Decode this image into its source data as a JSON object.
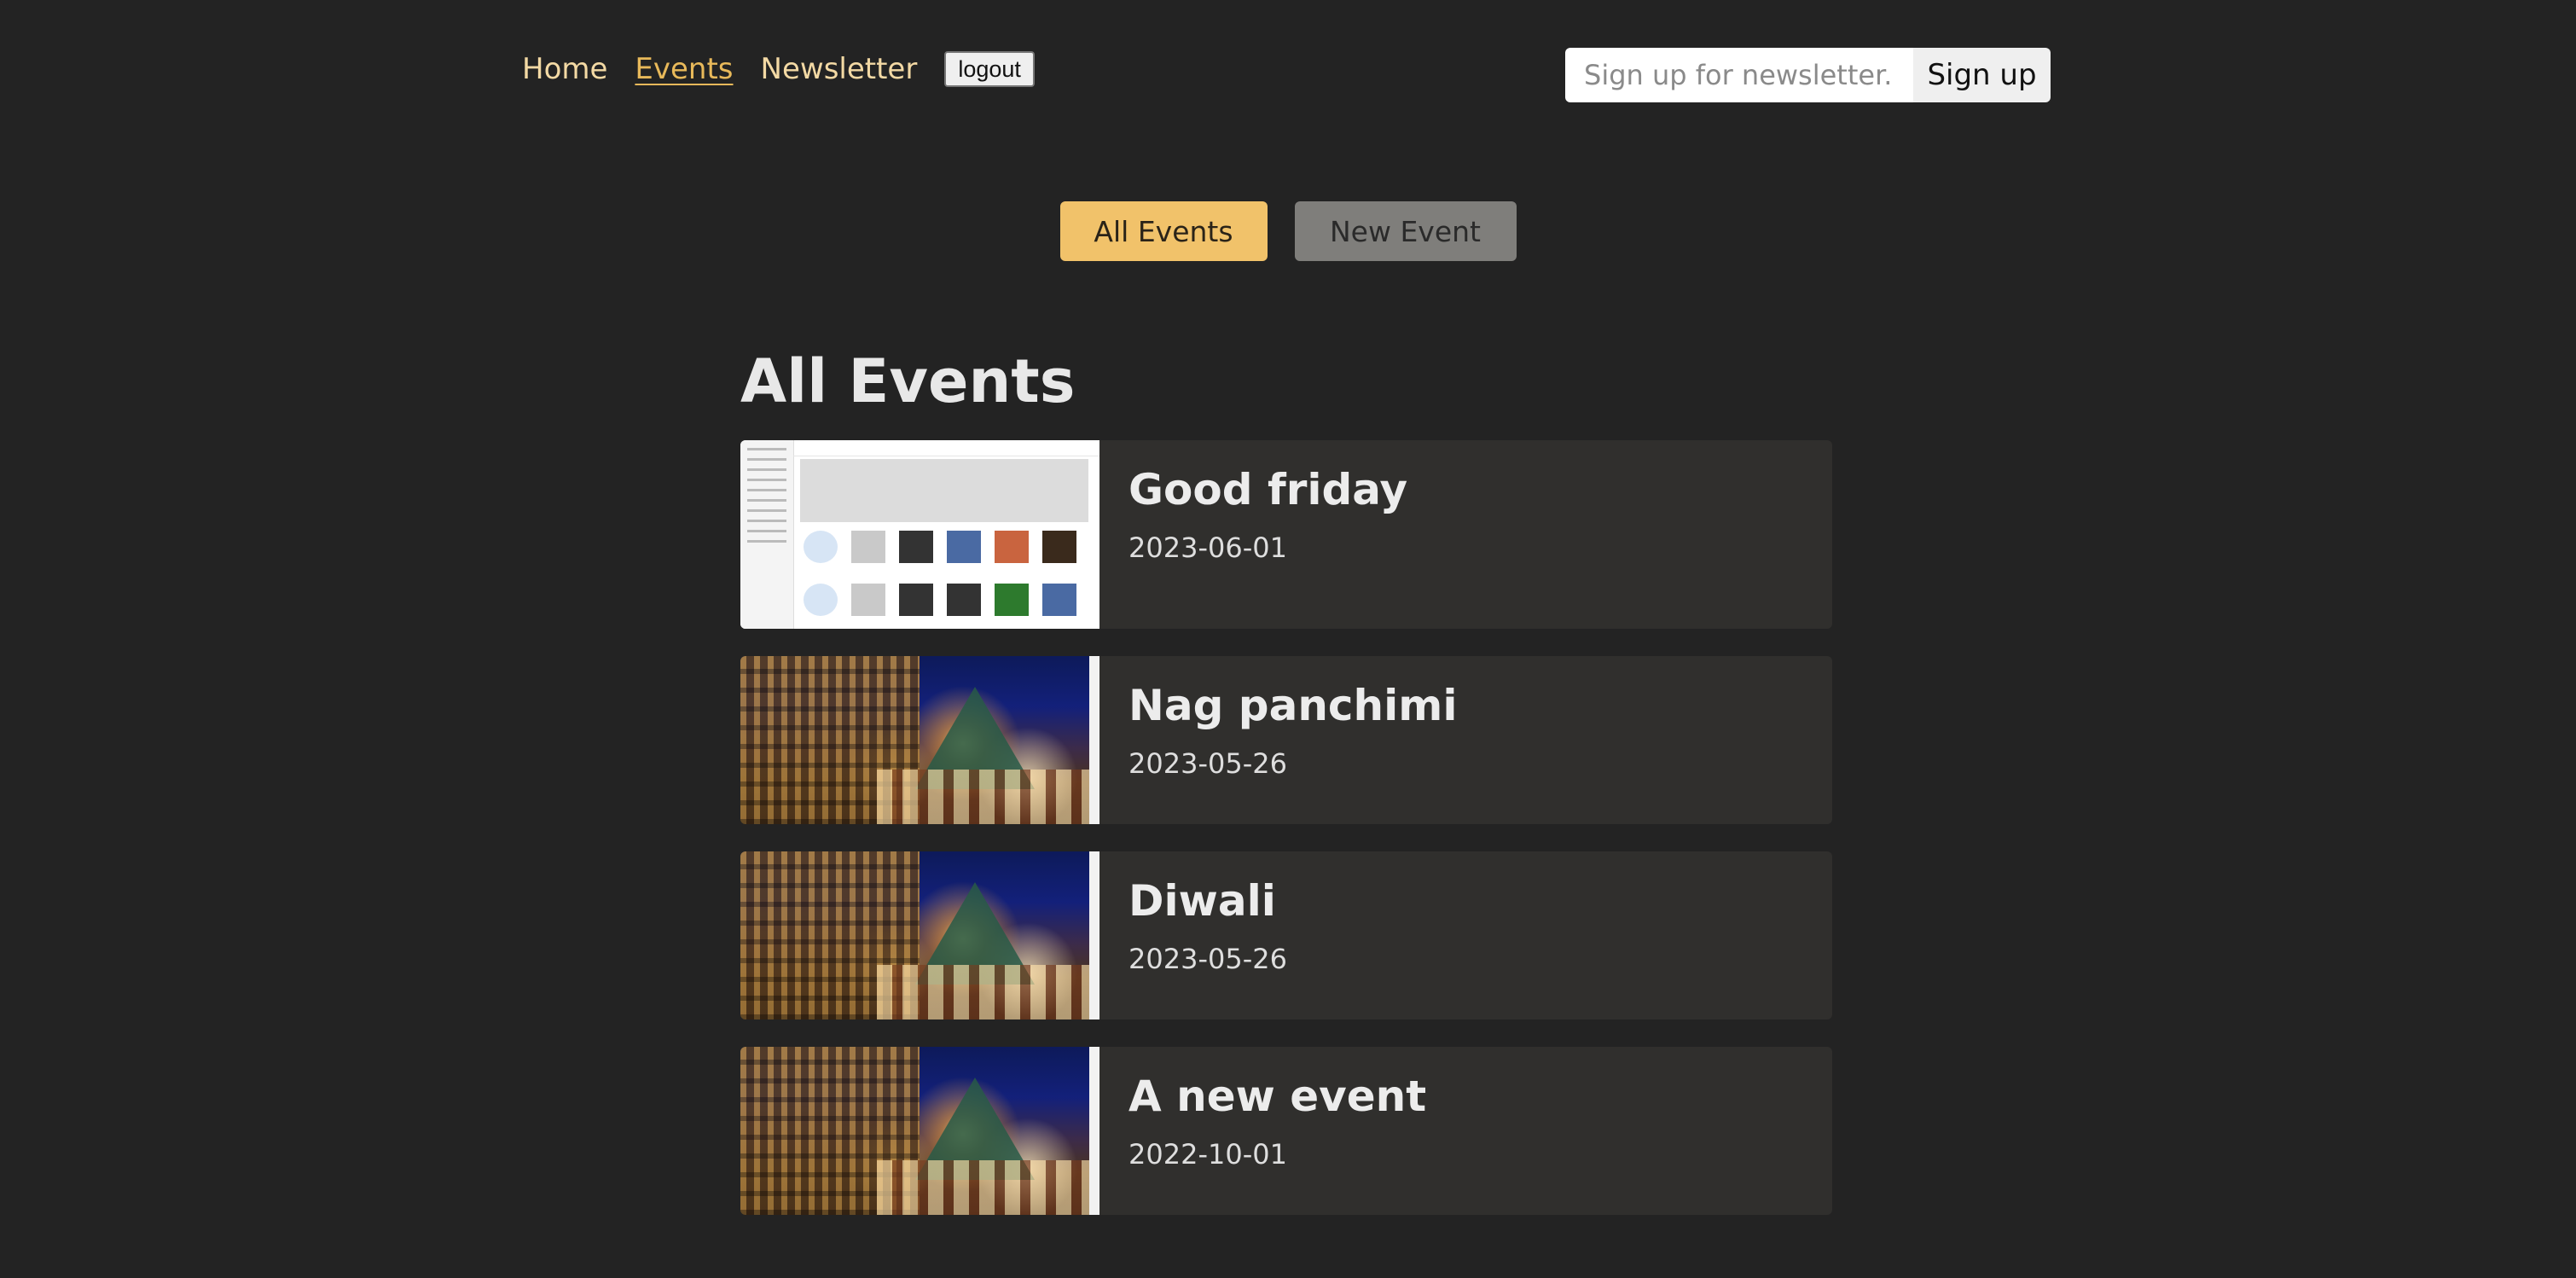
{
  "nav": {
    "links": [
      {
        "label": "Home"
      },
      {
        "label": "Events"
      },
      {
        "label": "Newsletter"
      }
    ],
    "logout_label": "logout"
  },
  "newsletter": {
    "placeholder": "Sign up for newsletter...",
    "value": "",
    "submit_label": "Sign up"
  },
  "tabs": {
    "all_events": "All Events",
    "new_event": "New Event"
  },
  "page": {
    "title": "All Events"
  },
  "events": [
    {
      "title": "Good friday",
      "date": "2023-06-01"
    },
    {
      "title": "Nag panchimi",
      "date": "2023-05-26"
    },
    {
      "title": "Diwali",
      "date": "2023-05-26"
    },
    {
      "title": "A new event",
      "date": "2022-10-01"
    }
  ],
  "colors": {
    "background": "#232323",
    "nav_link": "#f3d9a4",
    "nav_active": "#e8b95a",
    "tab_active": "#f1c26a",
    "tab_inactive": "#7f7e7b",
    "card": "#302f2d"
  }
}
